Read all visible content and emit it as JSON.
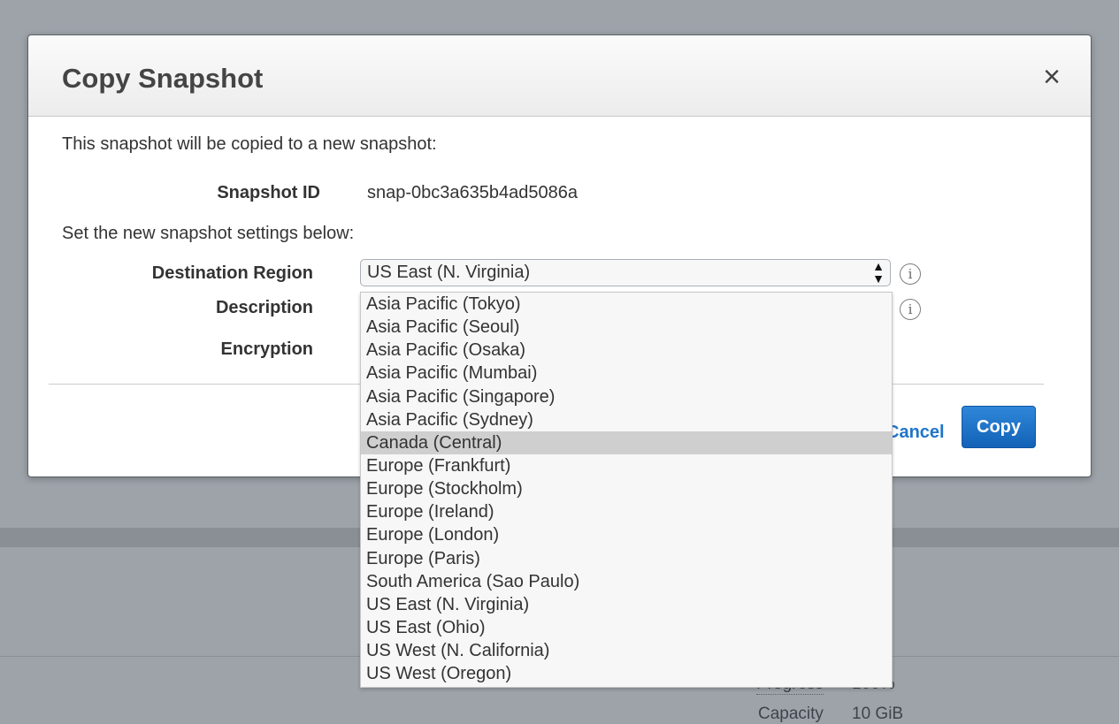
{
  "background": {
    "progress_label": "Progress",
    "progress_value": "100%",
    "capacity_label": "Capacity",
    "capacity_value": "10 GiB"
  },
  "dialog": {
    "title": "Copy Snapshot",
    "close_glyph": "×",
    "intro": "This snapshot will be copied to a new snapshot:",
    "snapshot_id_label": "Snapshot ID",
    "snapshot_id_value": "snap-0bc3a635b4ad5086a",
    "settings_intro": "Set the new snapshot settings below:",
    "destination_region_label": "Destination Region",
    "destination_region_selected": "US East (N. Virginia)",
    "description_label": "Description",
    "encryption_label": "Encryption",
    "info_glyph": "i",
    "cancel_label": "Cancel",
    "copy_label": "Copy"
  },
  "region_options": [
    "Asia Pacific (Tokyo)",
    "Asia Pacific (Seoul)",
    "Asia Pacific (Osaka)",
    "Asia Pacific (Mumbai)",
    "Asia Pacific (Singapore)",
    "Asia Pacific (Sydney)",
    "Canada (Central)",
    "Europe (Frankfurt)",
    "Europe (Stockholm)",
    "Europe (Ireland)",
    "Europe (London)",
    "Europe (Paris)",
    "South America (Sao Paulo)",
    "US East (N. Virginia)",
    "US East (Ohio)",
    "US West (N. California)",
    "US West (Oregon)"
  ],
  "highlighted_option": "Canada (Central)",
  "colors": {
    "accent": "#1f75c9",
    "primary_button": "#1a6fc4",
    "overlay": "#9ea3aa"
  }
}
